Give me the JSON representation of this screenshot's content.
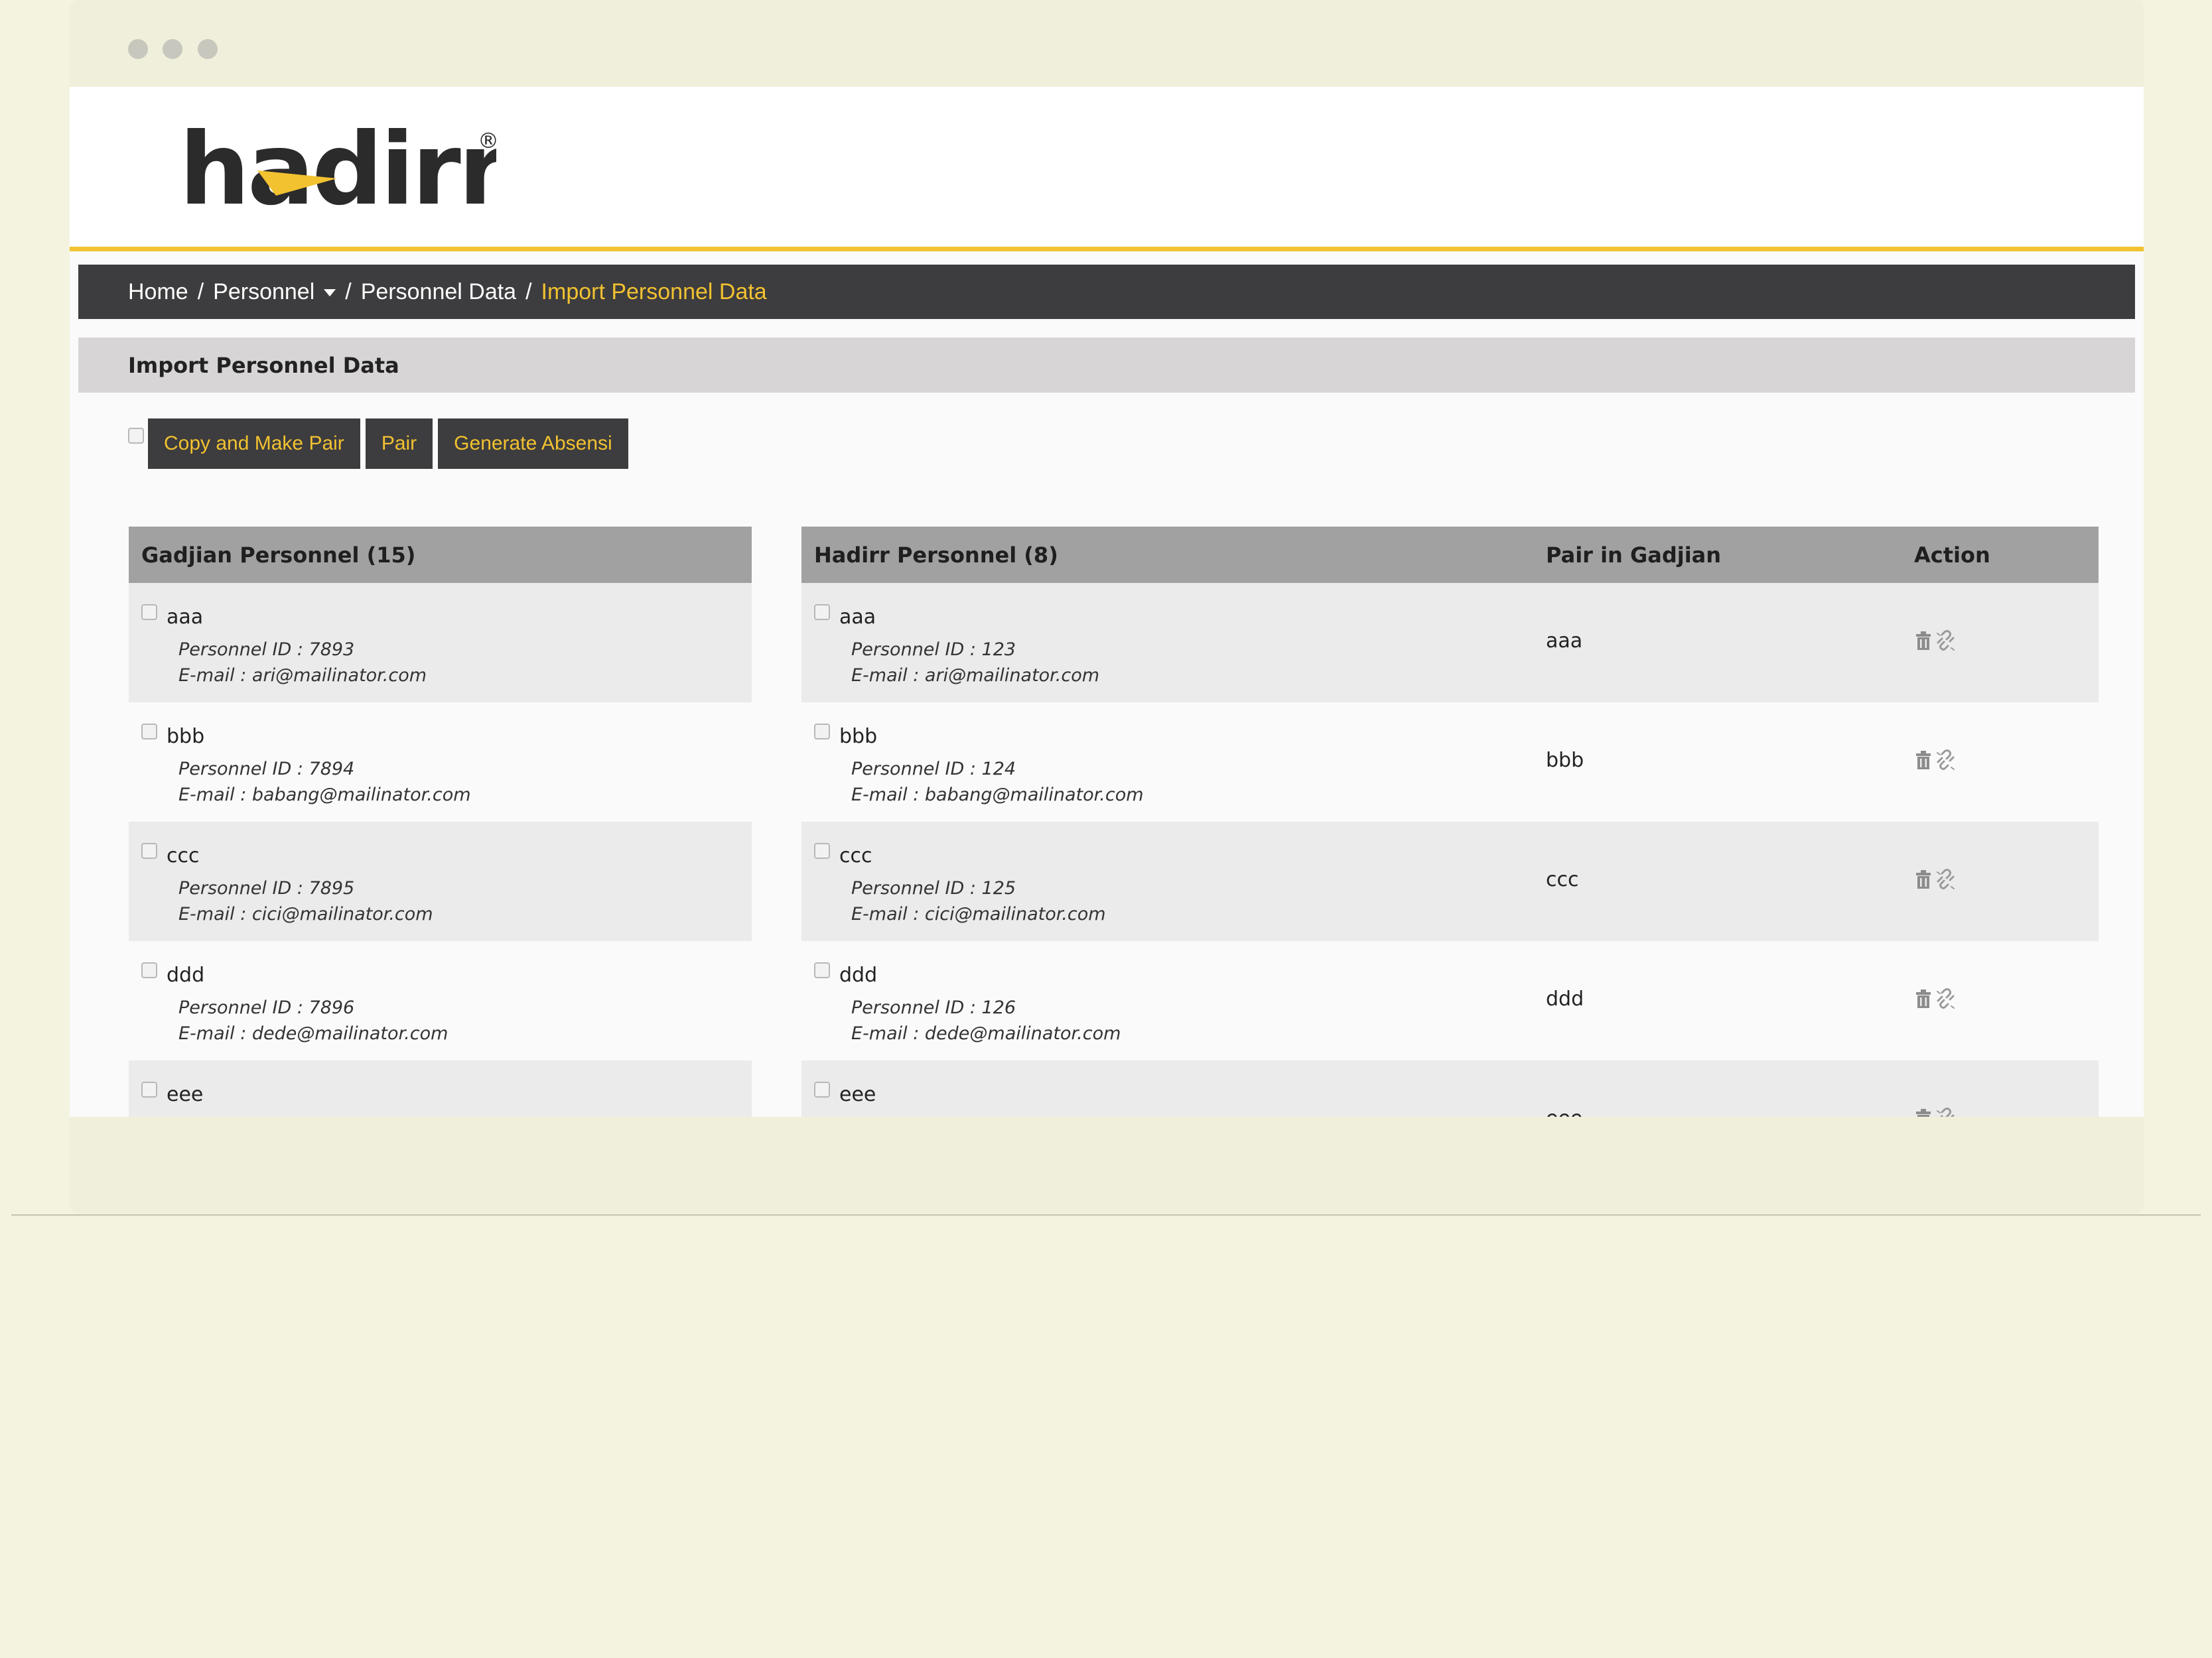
{
  "app": {
    "brand": "hadirr",
    "brand_mark": "®"
  },
  "breadcrumb": {
    "home": "Home",
    "personnel": "Personnel",
    "personnel_data": "Personnel Data",
    "current": "Import Personnel Data",
    "separator": "/"
  },
  "section": {
    "title": "Import Personnel Data"
  },
  "toolbar": {
    "copy_pair_label": "Copy and Make Pair",
    "pair_label": "Pair",
    "generate_label": "Generate Absensi"
  },
  "gadjian": {
    "title": "Gadjian Personnel (15)",
    "id_prefix": "Personnel ID : ",
    "email_prefix": "E-mail : ",
    "rows": [
      {
        "name": "aaa",
        "id": "7893",
        "email": "ari@mailinator.com"
      },
      {
        "name": "bbb",
        "id": "7894",
        "email": "babang@mailinator.com"
      },
      {
        "name": "ccc",
        "id": "7895",
        "email": "cici@mailinator.com"
      },
      {
        "name": "ddd",
        "id": "7896",
        "email": "dede@mailinator.com"
      },
      {
        "name": "eee"
      }
    ]
  },
  "hadirr": {
    "title": "Hadirr Personnel (8)",
    "pair_header": "Pair in Gadjian",
    "action_header": "Action",
    "id_prefix": "Personnel ID : ",
    "email_prefix": "E-mail : ",
    "rows": [
      {
        "name": "aaa",
        "id": "123",
        "email": "ari@mailinator.com",
        "pair": "aaa"
      },
      {
        "name": "bbb",
        "id": "124",
        "email": "babang@mailinator.com",
        "pair": "bbb"
      },
      {
        "name": "ccc",
        "id": "125",
        "email": "cici@mailinator.com",
        "pair": "ccc"
      },
      {
        "name": "ddd",
        "id": "126",
        "email": "dede@mailinator.com",
        "pair": "ddd"
      },
      {
        "name": "eee",
        "pair": "eee"
      }
    ]
  },
  "icons": {
    "delete": "trash-icon",
    "unpair": "unlink-icon"
  },
  "colors": {
    "accent": "#f2c230",
    "dark": "#3d3c3e",
    "header_gray": "#a1a1a1",
    "section_gray": "#d7d5d6"
  }
}
